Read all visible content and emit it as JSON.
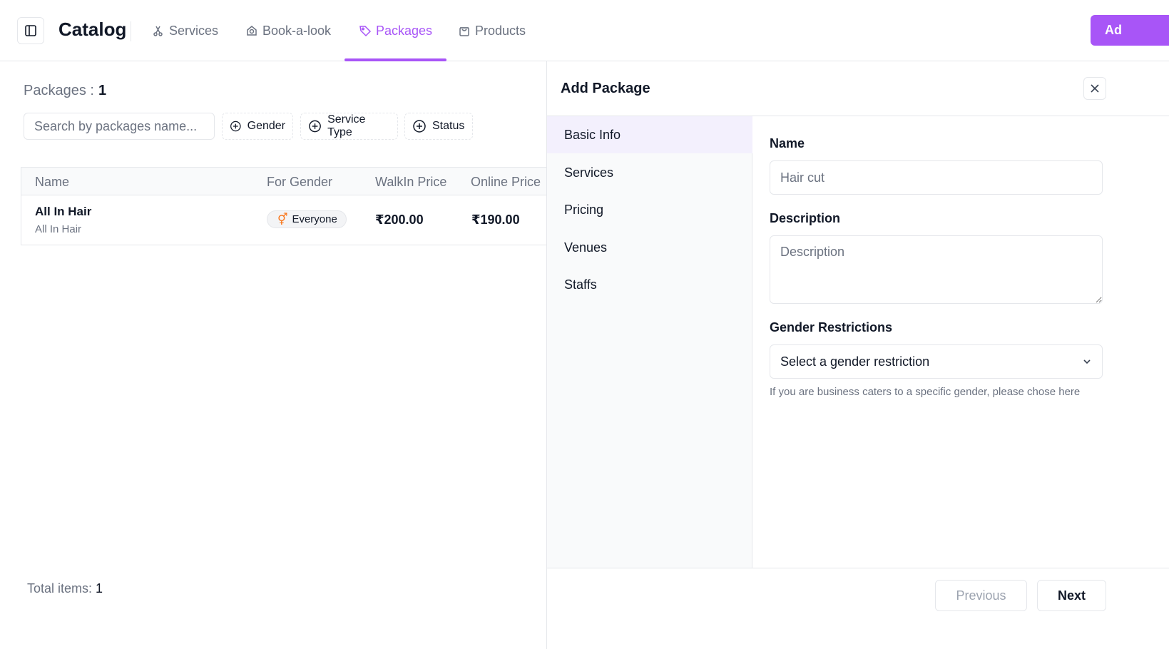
{
  "header": {
    "title": "Catalog",
    "tabs": [
      {
        "label": "Services",
        "icon": "scissors-icon"
      },
      {
        "label": "Book-a-look",
        "icon": "lookbook-icon"
      },
      {
        "label": "Packages",
        "icon": "tag-icon",
        "active": true
      },
      {
        "label": "Products",
        "icon": "shopping-bag-icon"
      }
    ],
    "add_button_label": "Ad",
    "accent_color": "#a855f7"
  },
  "list": {
    "count_label": "Packages :",
    "count_value": "1",
    "search_placeholder": "Search by packages name...",
    "filters": [
      "Gender",
      "Service Type",
      "Status"
    ],
    "columns": [
      "Name",
      "For Gender",
      "WalkIn Price",
      "Online Price"
    ],
    "rows": [
      {
        "name": "All In Hair",
        "subtitle": "All In Hair",
        "gender": "Everyone",
        "walkin_price": "₹200.00",
        "online_price": "₹190.00"
      }
    ],
    "total_label": "Total items:",
    "total_value": "1"
  },
  "drawer": {
    "title": "Add Package",
    "steps": [
      "Basic Info",
      "Services",
      "Pricing",
      "Venues",
      "Staffs"
    ],
    "active_step": "Basic Info",
    "form": {
      "name_label": "Name",
      "name_placeholder": "Hair cut",
      "description_label": "Description",
      "description_placeholder": "Description",
      "gender_label": "Gender Restrictions",
      "gender_select_value": "Select a gender restriction",
      "gender_help": "If you are business caters to a specific gender, please chose here"
    },
    "previous_label": "Previous",
    "next_label": "Next"
  }
}
